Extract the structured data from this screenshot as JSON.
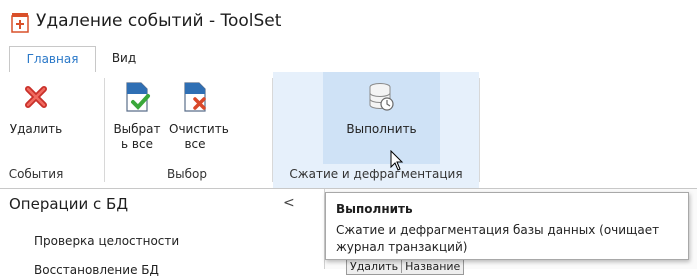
{
  "window": {
    "title": "Удаление событий - ToolSet"
  },
  "tabs": [
    {
      "label": "Главная",
      "active": true
    },
    {
      "label": "Вид",
      "active": false
    }
  ],
  "ribbon": {
    "groups": [
      {
        "label": "События",
        "buttons": [
          {
            "label": "Удалить",
            "icon": "delete-x-icon"
          }
        ]
      },
      {
        "label": "Выбор",
        "buttons": [
          {
            "label": "Выбрать все",
            "icon": "select-all-icon"
          },
          {
            "label": "Очистить все",
            "icon": "clear-all-icon"
          }
        ]
      },
      {
        "label": "Сжатие и дефрагментация",
        "buttons": [
          {
            "label": "Выполнить",
            "icon": "database-run-icon"
          }
        ]
      }
    ]
  },
  "left_panel": {
    "title": "Операции с БД",
    "collapse_glyph": "<",
    "items": [
      "Проверка целостности",
      "Восстановление БД"
    ]
  },
  "grid": {
    "columns": [
      "Удалить",
      "Название"
    ]
  },
  "tooltip": {
    "title": "Выполнить",
    "text": "Сжатие и дефрагментация базы данных (очищает журнал транзакций)"
  },
  "colors": {
    "accent": "#2a78c8",
    "hover": "#cfe2f6",
    "hover_group": "#e6f0fb"
  }
}
